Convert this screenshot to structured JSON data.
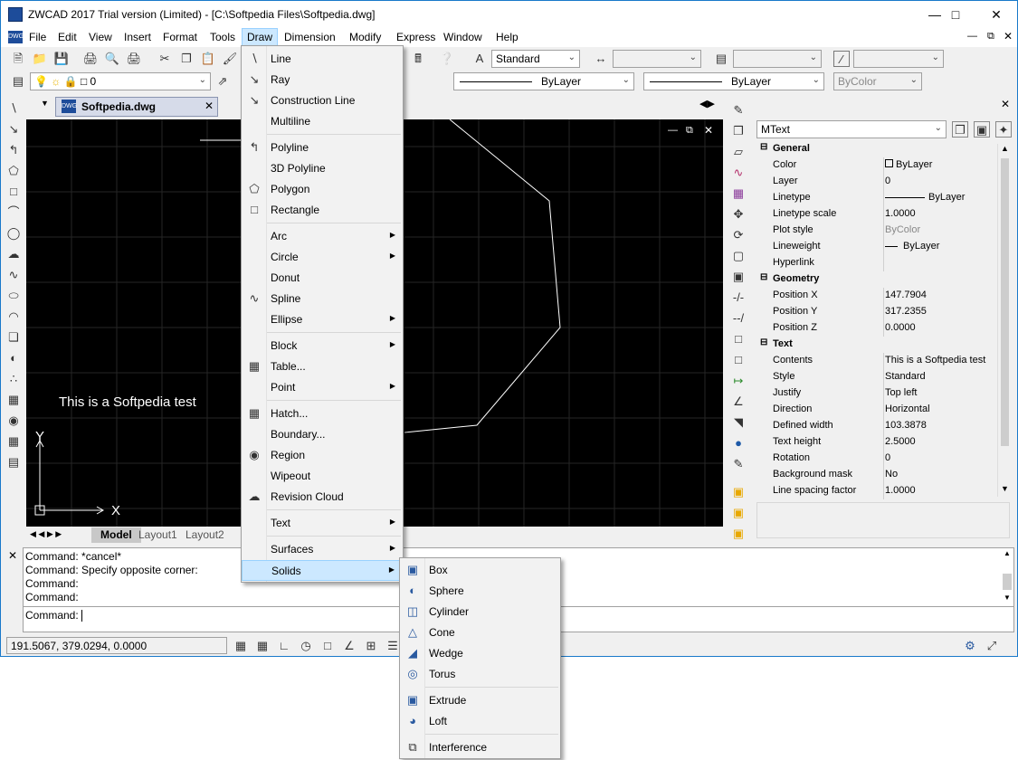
{
  "title": "ZWCAD 2017 Trial version (Limited) - [C:\\Softpedia Files\\Softpedia.dwg]",
  "menu": [
    "File",
    "Edit",
    "View",
    "Insert",
    "Format",
    "Tools",
    "Draw",
    "Dimension",
    "Modify",
    "Express",
    "Window",
    "Help"
  ],
  "toolbar": {
    "text_style": "Standard",
    "layer": "0",
    "linetype": "ByLayer",
    "lineweight": "ByLayer",
    "plotstyle": "ByColor"
  },
  "document_tab": "Softpedia.dwg",
  "canvas": {
    "text": "This is a Softpedia test",
    "axis_x": "X",
    "axis_y": "Y"
  },
  "layout_tabs": [
    "Model",
    "Layout1",
    "Layout2"
  ],
  "draw_menu": [
    {
      "label": "Line",
      "icon": "line-icon"
    },
    {
      "label": "Ray",
      "icon": "ray-icon"
    },
    {
      "label": "Construction Line",
      "icon": "xline-icon"
    },
    {
      "label": "Multiline",
      "icon": ""
    },
    {
      "label": "Polyline",
      "icon": "polyline-icon"
    },
    {
      "label": "3D Polyline",
      "icon": ""
    },
    {
      "label": "Polygon",
      "icon": "polygon-icon"
    },
    {
      "label": "Rectangle",
      "icon": "rectangle-icon"
    },
    {
      "label": "Arc",
      "icon": "",
      "submenu": true
    },
    {
      "label": "Circle",
      "icon": "",
      "submenu": true
    },
    {
      "label": "Donut",
      "icon": ""
    },
    {
      "label": "Spline",
      "icon": "spline-icon"
    },
    {
      "label": "Ellipse",
      "icon": "",
      "submenu": true
    },
    {
      "label": "Block",
      "icon": "",
      "submenu": true
    },
    {
      "label": "Table...",
      "icon": "table-icon"
    },
    {
      "label": "Point",
      "icon": "",
      "submenu": true
    },
    {
      "label": "Hatch...",
      "icon": "hatch-icon"
    },
    {
      "label": "Boundary...",
      "icon": ""
    },
    {
      "label": "Region",
      "icon": "region-icon"
    },
    {
      "label": "Wipeout",
      "icon": ""
    },
    {
      "label": "Revision Cloud",
      "icon": "revcloud-icon"
    },
    {
      "label": "Text",
      "icon": "",
      "submenu": true
    },
    {
      "label": "Surfaces",
      "icon": "",
      "submenu": true
    },
    {
      "label": "Solids",
      "icon": "",
      "submenu": true
    }
  ],
  "solids_menu": [
    {
      "label": "Box",
      "icon": "box-icon"
    },
    {
      "label": "Sphere",
      "icon": "sphere-icon"
    },
    {
      "label": "Cylinder",
      "icon": "cylinder-icon"
    },
    {
      "label": "Cone",
      "icon": "cone-icon"
    },
    {
      "label": "Wedge",
      "icon": "wedge-icon"
    },
    {
      "label": "Torus",
      "icon": "torus-icon"
    },
    {
      "label": "Extrude",
      "icon": "extrude-icon"
    },
    {
      "label": "Loft",
      "icon": "loft-icon"
    },
    {
      "label": "Interference",
      "icon": "interference-icon"
    }
  ],
  "properties": {
    "object_type": "MText",
    "groups": [
      {
        "name": "General",
        "rows": [
          {
            "key": "Color",
            "value": "ByLayer"
          },
          {
            "key": "Layer",
            "value": "0"
          },
          {
            "key": "Linetype",
            "value": "ByLayer"
          },
          {
            "key": "Linetype scale",
            "value": "1.0000"
          },
          {
            "key": "Plot style",
            "value": "ByColor"
          },
          {
            "key": "Lineweight",
            "value": "ByLayer"
          },
          {
            "key": "Hyperlink",
            "value": ""
          }
        ]
      },
      {
        "name": "Geometry",
        "rows": [
          {
            "key": "Position X",
            "value": "147.7904"
          },
          {
            "key": "Position Y",
            "value": "317.2355"
          },
          {
            "key": "Position Z",
            "value": "0.0000"
          }
        ]
      },
      {
        "name": "Text",
        "rows": [
          {
            "key": "Contents",
            "value": "This is a Softpedia test"
          },
          {
            "key": "Style",
            "value": "Standard"
          },
          {
            "key": "Justify",
            "value": "Top left"
          },
          {
            "key": "Direction",
            "value": "Horizontal"
          },
          {
            "key": "Defined width",
            "value": "103.3878"
          },
          {
            "key": "Text height",
            "value": "2.5000"
          },
          {
            "key": "Rotation",
            "value": "0"
          },
          {
            "key": "Background mask",
            "value": "No"
          },
          {
            "key": "Line spacing factor",
            "value": "1.0000"
          }
        ]
      }
    ]
  },
  "command_history": [
    "Command: *cancel*",
    "Command: Specify opposite corner:",
    "Command:",
    "Command:"
  ],
  "command_prompt": "Command:",
  "coordinates": "191.5067, 379.0294, 0.0000"
}
